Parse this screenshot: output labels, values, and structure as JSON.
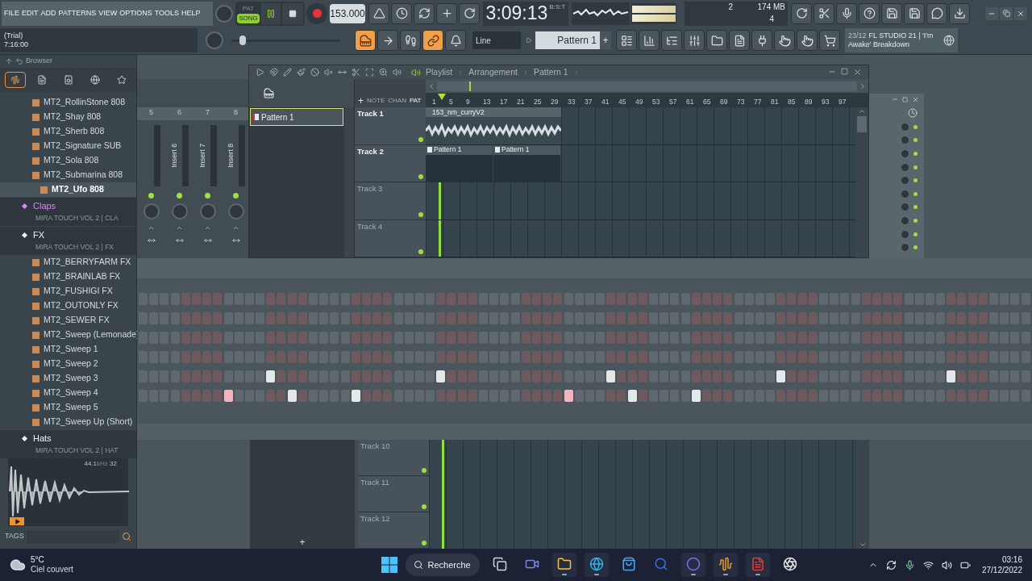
{
  "menu": [
    "FILE",
    "EDIT",
    "ADD",
    "PATTERNS",
    "VIEW",
    "OPTIONS",
    "TOOLS",
    "HELP"
  ],
  "hint": {
    "title": "(Trial)",
    "value": "7:16:00"
  },
  "transport": {
    "modes": [
      {
        "label": "PAT",
        "selected": false
      },
      {
        "label": "SONG",
        "selected": true
      }
    ],
    "playing": true,
    "tempo": "153.000"
  },
  "time": {
    "value": "3:09:13",
    "unit": "B:S:T"
  },
  "monitor": {
    "value_1": "2",
    "memory": "174 MB",
    "value_2": "4"
  },
  "tool_buttons": [
    {
      "kind": "typing",
      "on": true
    },
    {
      "kind": "arrow",
      "on": false
    },
    {
      "kind": "step",
      "on": false
    },
    {
      "kind": "link",
      "on": true
    },
    {
      "kind": "metronome",
      "on": false
    }
  ],
  "snap": "Line",
  "pattern": {
    "label": "Pattern 1",
    "plus": "+"
  },
  "news": {
    "date": "23/12",
    "title": "FL STUDIO 21 | 'I'm Awake' Breakdown"
  },
  "browser": {
    "title": "Browser",
    "tabs": [
      {
        "kind": "all",
        "selected": true
      },
      {
        "kind": "files",
        "selected": false
      },
      {
        "kind": "sounds",
        "selected": false
      },
      {
        "kind": "web",
        "selected": false
      },
      {
        "kind": "starred",
        "selected": false
      }
    ],
    "items": [
      {
        "kind": "file",
        "label": "MT2_RollinStone 808",
        "selected": false
      },
      {
        "kind": "file",
        "label": "MT2_Shay 808",
        "selected": false
      },
      {
        "kind": "file",
        "label": "MT2_Sherb 808",
        "selected": false
      },
      {
        "kind": "file",
        "label": "MT2_Signature SUB",
        "selected": false
      },
      {
        "kind": "file",
        "label": "MT2_Sola 808",
        "selected": false
      },
      {
        "kind": "file",
        "label": "MT2_Submarina 808",
        "selected": false
      },
      {
        "kind": "file",
        "label": "MT2_Ufo 808",
        "selected": true
      },
      {
        "kind": "folder",
        "label": "Claps",
        "subtitle": "MIRA TOUCH VOL 2 | CLA",
        "color": "#d68cf0"
      },
      {
        "kind": "folder",
        "label": "FX",
        "subtitle": "MIRA TOUCH VOL 2 | FX",
        "color": "#f2f2f2"
      },
      {
        "kind": "file",
        "label": "MT2_BERRYFARM FX",
        "selected": false
      },
      {
        "kind": "file",
        "label": "MT2_BRAINLAB FX",
        "selected": false
      },
      {
        "kind": "file",
        "label": "MT2_FUSHIGI FX",
        "selected": false
      },
      {
        "kind": "file",
        "label": "MT2_OUTONLY FX",
        "selected": false
      },
      {
        "kind": "file",
        "label": "MT2_SEWER FX",
        "selected": false
      },
      {
        "kind": "file",
        "label": "MT2_Sweep (Lemonade)",
        "selected": false
      },
      {
        "kind": "file",
        "label": "MT2_Sweep 1",
        "selected": false
      },
      {
        "kind": "file",
        "label": "MT2_Sweep 2",
        "selected": false
      },
      {
        "kind": "file",
        "label": "MT2_Sweep 3",
        "selected": false
      },
      {
        "kind": "file",
        "label": "MT2_Sweep 4",
        "selected": false
      },
      {
        "kind": "file",
        "label": "MT2_Sweep 5",
        "selected": false
      },
      {
        "kind": "file",
        "label": "MT2_Sweep Up (Short)",
        "selected": false
      },
      {
        "kind": "folder",
        "label": "Hats",
        "subtitle": "MIRA TOUCH VOL 2 | HAT",
        "color": "#f2f2f2"
      }
    ],
    "sample": {
      "rate": "44.1",
      "unit": "kHz",
      "bits": "32"
    },
    "tags": "TAGS"
  },
  "mixer": [
    {
      "number": "5"
    },
    {
      "number": "6",
      "label": "Insert 6"
    },
    {
      "number": "7",
      "label": "Insert 7"
    },
    {
      "number": "8",
      "label": "Insert 8"
    }
  ],
  "playlist": {
    "breadcrumb": [
      "Playlist",
      "Arrangement",
      "Pattern 1"
    ],
    "patterns": [
      {
        "label": "Pattern 1",
        "selected": true
      }
    ],
    "modes": [
      {
        "label": "NOTE",
        "selected": false
      },
      {
        "label": "CHAN",
        "selected": false
      },
      {
        "label": "PAT",
        "selected": true
      }
    ],
    "ruler": [
      "1",
      "5",
      "9",
      "13",
      "17",
      "21",
      "25",
      "29",
      "33",
      "37",
      "41",
      "45",
      "49",
      "53",
      "57",
      "61",
      "65",
      "69",
      "73",
      "77",
      "81",
      "85",
      "89",
      "93",
      "97"
    ],
    "tracks": [
      {
        "name": "Track 1",
        "empty": false,
        "clips": [
          {
            "kind": "audio",
            "label": "153_nm_curryV2"
          }
        ]
      },
      {
        "name": "Track 2",
        "empty": false,
        "clips": [
          {
            "kind": "pattern",
            "label": "Pattern 1"
          },
          {
            "kind": "pattern",
            "label": "Pattern 1"
          }
        ]
      },
      {
        "name": "Track 3",
        "empty": true
      },
      {
        "name": "Track 4",
        "empty": true
      }
    ],
    "lower_tracks": [
      {
        "name": "Track 10",
        "empty": true
      },
      {
        "name": "Track 11",
        "empty": true
      },
      {
        "name": "Track 12",
        "empty": true
      }
    ],
    "add": "+"
  },
  "master": {
    "level": 0.08
  },
  "steps": [
    {
      "steps": [
        {
          "on": false
        },
        {
          "on": false
        },
        {
          "on": false
        },
        {
          "on": false
        },
        {
          "on": false
        },
        {
          "on": false
        },
        {
          "on": false
        },
        {
          "on": false
        },
        {
          "on": false
        },
        {
          "on": false
        },
        {
          "on": false
        },
        {
          "on": false
        },
        {
          "on": false
        },
        {
          "on": false
        },
        {
          "on": false
        },
        {
          "on": false
        },
        {
          "on": false
        },
        {
          "on": false
        },
        {
          "on": false
        },
        {
          "on": false
        },
        {
          "on": false
        },
        {
          "on": false
        },
        {
          "on": false
        },
        {
          "on": false
        },
        {
          "on": false
        },
        {
          "on": false
        },
        {
          "on": false
        },
        {
          "on": false
        },
        {
          "on": false
        },
        {
          "on": false
        },
        {
          "on": false
        },
        {
          "on": false
        },
        {
          "on": false
        },
        {
          "on": false
        },
        {
          "on": false
        },
        {
          "on": false
        },
        {
          "on": false
        },
        {
          "on": false
        },
        {
          "on": false
        },
        {
          "on": false
        },
        {
          "on": false
        },
        {
          "on": false
        },
        {
          "on": false
        },
        {
          "on": false
        },
        {
          "on": false
        },
        {
          "on": false
        },
        {
          "on": false
        },
        {
          "on": false
        },
        {
          "on": false
        },
        {
          "on": false
        },
        {
          "on": false
        },
        {
          "on": false
        },
        {
          "on": false
        },
        {
          "on": false
        },
        {
          "on": false
        },
        {
          "on": false
        },
        {
          "on": false
        },
        {
          "on": false
        },
        {
          "on": false
        },
        {
          "on": false
        },
        {
          "on": false
        },
        {
          "on": false
        },
        {
          "on": false
        },
        {
          "on": false
        },
        {
          "on": false
        },
        {
          "on": false
        },
        {
          "on": false
        },
        {
          "on": false
        },
        {
          "on": false
        },
        {
          "on": false
        },
        {
          "on": false
        },
        {
          "on": false
        },
        {
          "on": false
        },
        {
          "on": false
        },
        {
          "on": false
        },
        {
          "on": false
        },
        {
          "on": false
        },
        {
          "on": false
        },
        {
          "on": false
        },
        {
          "on": false
        },
        {
          "on": false
        },
        {
          "on": false
        },
        {
          "on": false
        },
        {
          "on": false
        }
      ]
    },
    {
      "steps": [
        {
          "on": false
        },
        {
          "on": false
        },
        {
          "on": false
        },
        {
          "on": false
        },
        {
          "on": false
        },
        {
          "on": false
        },
        {
          "on": false
        },
        {
          "on": false
        },
        {
          "on": false
        },
        {
          "on": false
        },
        {
          "on": false
        },
        {
          "on": false
        },
        {
          "on": false
        },
        {
          "on": false
        },
        {
          "on": false
        },
        {
          "on": false
        },
        {
          "on": false
        },
        {
          "on": false
        },
        {
          "on": false
        },
        {
          "on": false
        },
        {
          "on": false
        },
        {
          "on": false
        },
        {
          "on": false
        },
        {
          "on": false
        },
        {
          "on": false
        },
        {
          "on": false
        },
        {
          "on": false
        },
        {
          "on": false
        },
        {
          "on": false
        },
        {
          "on": false
        },
        {
          "on": false
        },
        {
          "on": false
        },
        {
          "on": false
        },
        {
          "on": false
        },
        {
          "on": false
        },
        {
          "on": false
        },
        {
          "on": false
        },
        {
          "on": false
        },
        {
          "on": false
        },
        {
          "on": false
        },
        {
          "on": false
        },
        {
          "on": false
        },
        {
          "on": false
        },
        {
          "on": false
        },
        {
          "on": false
        },
        {
          "on": false
        },
        {
          "on": false
        },
        {
          "on": false
        },
        {
          "on": false
        },
        {
          "on": false
        },
        {
          "on": false
        },
        {
          "on": false
        },
        {
          "on": false
        },
        {
          "on": false
        },
        {
          "on": false
        },
        {
          "on": false
        },
        {
          "on": false
        },
        {
          "on": false
        },
        {
          "on": false
        },
        {
          "on": false
        },
        {
          "on": false
        },
        {
          "on": false
        },
        {
          "on": false
        },
        {
          "on": false
        },
        {
          "on": false
        },
        {
          "on": false
        },
        {
          "on": false
        },
        {
          "on": false
        },
        {
          "on": false
        },
        {
          "on": false
        },
        {
          "on": false
        },
        {
          "on": false
        },
        {
          "on": false
        },
        {
          "on": false
        },
        {
          "on": false
        },
        {
          "on": false
        },
        {
          "on": false
        },
        {
          "on": false
        },
        {
          "on": false
        },
        {
          "on": false
        },
        {
          "on": false
        },
        {
          "on": false
        },
        {
          "on": false
        },
        {
          "on": false
        }
      ]
    },
    {
      "steps": [
        {
          "on": false
        },
        {
          "on": false
        },
        {
          "on": false
        },
        {
          "on": false
        },
        {
          "on": false
        },
        {
          "on": false
        },
        {
          "on": false
        },
        {
          "on": false
        },
        {
          "on": false
        },
        {
          "on": false
        },
        {
          "on": false
        },
        {
          "on": false
        },
        {
          "on": false
        },
        {
          "on": false
        },
        {
          "on": false
        },
        {
          "on": false
        },
        {
          "on": false
        },
        {
          "on": false
        },
        {
          "on": false
        },
        {
          "on": false
        },
        {
          "on": false
        },
        {
          "on": false
        },
        {
          "on": false
        },
        {
          "on": false
        },
        {
          "on": false
        },
        {
          "on": false
        },
        {
          "on": false
        },
        {
          "on": false
        },
        {
          "on": false
        },
        {
          "on": false
        },
        {
          "on": false
        },
        {
          "on": false
        },
        {
          "on": false
        },
        {
          "on": false
        },
        {
          "on": false
        },
        {
          "on": false
        },
        {
          "on": false
        },
        {
          "on": false
        },
        {
          "on": false
        },
        {
          "on": false
        },
        {
          "on": false
        },
        {
          "on": false
        },
        {
          "on": false
        },
        {
          "on": false
        },
        {
          "on": false
        },
        {
          "on": false
        },
        {
          "on": false
        },
        {
          "on": false
        },
        {
          "on": false
        },
        {
          "on": false
        },
        {
          "on": false
        },
        {
          "on": false
        },
        {
          "on": false
        },
        {
          "on": false
        },
        {
          "on": false
        },
        {
          "on": false
        },
        {
          "on": false
        },
        {
          "on": false
        },
        {
          "on": false
        },
        {
          "on": false
        },
        {
          "on": false
        },
        {
          "on": false
        },
        {
          "on": false
        },
        {
          "on": false
        },
        {
          "on": false
        },
        {
          "on": false
        },
        {
          "on": false
        },
        {
          "on": false
        },
        {
          "on": false
        },
        {
          "on": false
        },
        {
          "on": false
        },
        {
          "on": false
        },
        {
          "on": false
        },
        {
          "on": false
        },
        {
          "on": false
        },
        {
          "on": false
        },
        {
          "on": false
        },
        {
          "on": false
        },
        {
          "on": false
        },
        {
          "on": false
        },
        {
          "on": false
        },
        {
          "on": false
        },
        {
          "on": false
        },
        {
          "on": false
        }
      ]
    },
    {
      "steps": [
        {
          "on": false
        },
        {
          "on": false
        },
        {
          "on": false
        },
        {
          "on": false
        },
        {
          "on": false
        },
        {
          "on": false
        },
        {
          "on": false
        },
        {
          "on": false
        },
        {
          "on": false
        },
        {
          "on": false
        },
        {
          "on": false
        },
        {
          "on": false
        },
        {
          "on": false
        },
        {
          "on": false
        },
        {
          "on": false
        },
        {
          "on": false
        },
        {
          "on": false
        },
        {
          "on": false
        },
        {
          "on": false
        },
        {
          "on": false
        },
        {
          "on": false
        },
        {
          "on": false
        },
        {
          "on": false
        },
        {
          "on": false
        },
        {
          "on": false
        },
        {
          "on": false
        },
        {
          "on": false
        },
        {
          "on": false
        },
        {
          "on": false
        },
        {
          "on": false
        },
        {
          "on": false
        },
        {
          "on": false
        },
        {
          "on": false
        },
        {
          "on": false
        },
        {
          "on": false
        },
        {
          "on": false
        },
        {
          "on": false
        },
        {
          "on": false
        },
        {
          "on": false
        },
        {
          "on": false
        },
        {
          "on": false
        },
        {
          "on": false
        },
        {
          "on": false
        },
        {
          "on": false
        },
        {
          "on": false
        },
        {
          "on": false
        },
        {
          "on": false
        },
        {
          "on": false
        },
        {
          "on": false
        },
        {
          "on": false
        },
        {
          "on": false
        },
        {
          "on": false
        },
        {
          "on": false
        },
        {
          "on": false
        },
        {
          "on": false
        },
        {
          "on": false
        },
        {
          "on": false
        },
        {
          "on": false
        },
        {
          "on": false
        },
        {
          "on": false
        },
        {
          "on": false
        },
        {
          "on": false
        },
        {
          "on": false
        },
        {
          "on": false
        },
        {
          "on": false
        },
        {
          "on": false
        },
        {
          "on": false
        },
        {
          "on": false
        },
        {
          "on": false
        },
        {
          "on": false
        },
        {
          "on": false
        },
        {
          "on": false
        },
        {
          "on": false
        },
        {
          "on": false
        },
        {
          "on": false
        },
        {
          "on": false
        },
        {
          "on": false
        },
        {
          "on": false
        },
        {
          "on": false
        },
        {
          "on": false
        },
        {
          "on": false
        },
        {
          "on": false
        },
        {
          "on": false
        },
        {
          "on": false
        }
      ]
    },
    {
      "steps": [
        {
          "on": false
        },
        {
          "on": false
        },
        {
          "on": false
        },
        {
          "on": false
        },
        {
          "on": false
        },
        {
          "on": false
        },
        {
          "on": false
        },
        {
          "on": false
        },
        {
          "on": false
        },
        {
          "on": false
        },
        {
          "on": false
        },
        {
          "on": false
        },
        {
          "on": true
        },
        {
          "on": false
        },
        {
          "on": false
        },
        {
          "on": false
        },
        {
          "on": false
        },
        {
          "on": false
        },
        {
          "on": false
        },
        {
          "on": false
        },
        {
          "on": false
        },
        {
          "on": false
        },
        {
          "on": false
        },
        {
          "on": false
        },
        {
          "on": false
        },
        {
          "on": false
        },
        {
          "on": false
        },
        {
          "on": false
        },
        {
          "on": true
        },
        {
          "on": false
        },
        {
          "on": false
        },
        {
          "on": false
        },
        {
          "on": false
        },
        {
          "on": false
        },
        {
          "on": false
        },
        {
          "on": false
        },
        {
          "on": false
        },
        {
          "on": false
        },
        {
          "on": false
        },
        {
          "on": false
        },
        {
          "on": false
        },
        {
          "on": false
        },
        {
          "on": false
        },
        {
          "on": false
        },
        {
          "on": true
        },
        {
          "on": false
        },
        {
          "on": false
        },
        {
          "on": false
        },
        {
          "on": false
        },
        {
          "on": false
        },
        {
          "on": false
        },
        {
          "on": false
        },
        {
          "on": false
        },
        {
          "on": false
        },
        {
          "on": false
        },
        {
          "on": false
        },
        {
          "on": false
        },
        {
          "on": false
        },
        {
          "on": false
        },
        {
          "on": false
        },
        {
          "on": true
        },
        {
          "on": false
        },
        {
          "on": false
        },
        {
          "on": false
        },
        {
          "on": false
        },
        {
          "on": false
        },
        {
          "on": false
        },
        {
          "on": false
        },
        {
          "on": false
        },
        {
          "on": false
        },
        {
          "on": false
        },
        {
          "on": false
        },
        {
          "on": false
        },
        {
          "on": false
        },
        {
          "on": false
        },
        {
          "on": false
        },
        {
          "on": true
        },
        {
          "on": false
        },
        {
          "on": false
        },
        {
          "on": false
        },
        {
          "on": false
        },
        {
          "on": false
        },
        {
          "on": false
        },
        {
          "on": false
        }
      ]
    },
    {
      "steps": [
        {
          "on": false
        },
        {
          "on": false
        },
        {
          "on": false
        },
        {
          "on": false
        },
        {
          "on": false
        },
        {
          "on": false
        },
        {
          "on": false
        },
        {
          "on": false
        },
        {
          "on": true,
          "color": "#f0b5bf"
        },
        {
          "on": false
        },
        {
          "on": false
        },
        {
          "on": false
        },
        {
          "on": false
        },
        {
          "on": false
        },
        {
          "on": true,
          "color": "#e4e8ea"
        },
        {
          "on": false
        },
        {
          "on": false
        },
        {
          "on": false
        },
        {
          "on": false
        },
        {
          "on": false
        },
        {
          "on": true,
          "color": "#e4e8ea"
        },
        {
          "on": false
        },
        {
          "on": false
        },
        {
          "on": false
        },
        {
          "on": false
        },
        {
          "on": false
        },
        {
          "on": false
        },
        {
          "on": false
        },
        {
          "on": false
        },
        {
          "on": false
        },
        {
          "on": false
        },
        {
          "on": false
        },
        {
          "on": false
        },
        {
          "on": false
        },
        {
          "on": false
        },
        {
          "on": false
        },
        {
          "on": false
        },
        {
          "on": false
        },
        {
          "on": false
        },
        {
          "on": false
        },
        {
          "on": true,
          "color": "#f0b5bf"
        },
        {
          "on": false
        },
        {
          "on": false
        },
        {
          "on": false
        },
        {
          "on": false
        },
        {
          "on": false
        },
        {
          "on": true,
          "color": "#e4e8ea"
        },
        {
          "on": false
        },
        {
          "on": false
        },
        {
          "on": false
        },
        {
          "on": false
        },
        {
          "on": false
        },
        {
          "on": true,
          "color": "#e4e8ea"
        },
        {
          "on": false
        },
        {
          "on": false
        },
        {
          "on": false
        },
        {
          "on": false
        },
        {
          "on": false
        },
        {
          "on": false
        },
        {
          "on": false
        },
        {
          "on": false
        },
        {
          "on": false
        },
        {
          "on": false
        },
        {
          "on": false
        },
        {
          "on": false
        },
        {
          "on": false
        },
        {
          "on": false
        },
        {
          "on": false
        },
        {
          "on": false
        },
        {
          "on": false
        },
        {
          "on": false
        },
        {
          "on": false
        },
        {
          "on": false
        },
        {
          "on": false
        },
        {
          "on": false
        },
        {
          "on": false
        },
        {
          "on": false
        },
        {
          "on": false
        },
        {
          "on": false
        },
        {
          "on": false
        },
        {
          "on": false
        },
        {
          "on": false
        },
        {
          "on": false
        },
        {
          "on": false
        }
      ]
    }
  ],
  "taskbar": {
    "weather": {
      "temp": "5°C",
      "text": "Ciel couvert"
    },
    "search": "Recherche",
    "apps": [
      {
        "kind": "taskview",
        "active": false
      },
      {
        "kind": "chat",
        "active": false
      },
      {
        "kind": "explorer",
        "active": true
      },
      {
        "kind": "browser",
        "active": true
      },
      {
        "kind": "store",
        "active": false
      },
      {
        "kind": "search-app",
        "active": false
      },
      {
        "kind": "circle-app",
        "active": true
      },
      {
        "kind": "fl",
        "active": true
      },
      {
        "kind": "red-app",
        "active": true
      },
      {
        "kind": "obs",
        "active": false
      }
    ],
    "time": "03:16",
    "date": "27/12/2022"
  }
}
